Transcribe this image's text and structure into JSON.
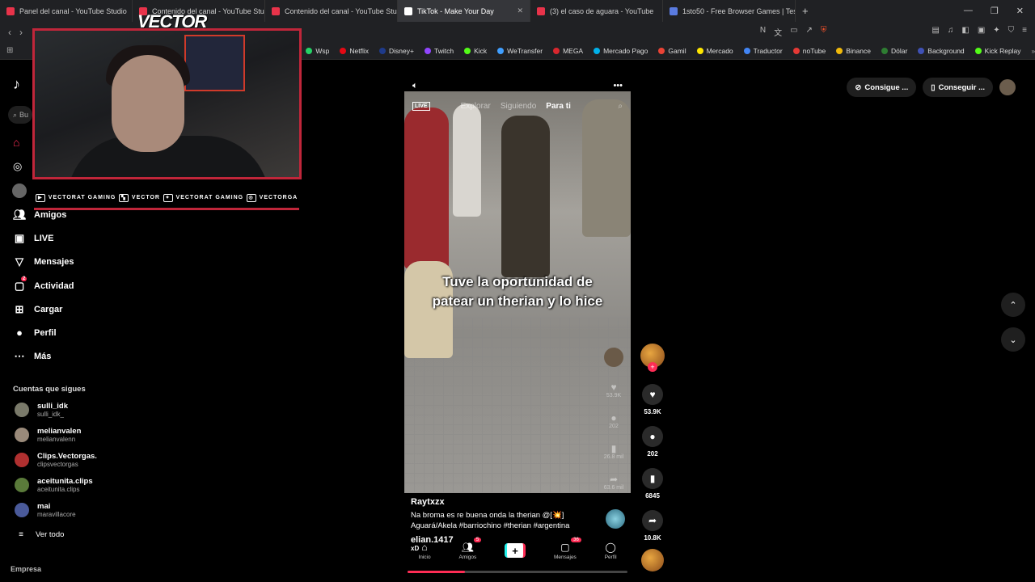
{
  "browser": {
    "tabs": [
      {
        "title": "Panel del canal - YouTube Studio",
        "color": "#e8334a",
        "active": false
      },
      {
        "title": "Contenido del canal - YouTube Studio",
        "color": "#e8334a",
        "active": false
      },
      {
        "title": "Contenido del canal - YouTube Studio",
        "color": "#e8334a",
        "active": false
      },
      {
        "title": "TikTok - Make Your Day",
        "color": "#ffffff",
        "active": true
      },
      {
        "title": "(3) el caso de aguara - YouTube",
        "color": "#e8334a",
        "active": false
      },
      {
        "title": "1sto50 - Free Browser Games | Test Y",
        "color": "#5a7be0",
        "active": false
      }
    ],
    "bookmarks": [
      {
        "label": "Wsp",
        "color": "#25d366"
      },
      {
        "label": "Netflix",
        "color": "#e50914"
      },
      {
        "label": "Disney+",
        "color": "#1e3a8a"
      },
      {
        "label": "Twitch",
        "color": "#9146ff"
      },
      {
        "label": "Kick",
        "color": "#53fc18"
      },
      {
        "label": "WeTransfer",
        "color": "#409fff"
      },
      {
        "label": "MEGA",
        "color": "#d9272e"
      },
      {
        "label": "Mercado Pago",
        "color": "#00b1ea"
      },
      {
        "label": "Gamil",
        "color": "#ea4335"
      },
      {
        "label": "Mercado",
        "color": "#ffe600"
      },
      {
        "label": "Traductor",
        "color": "#4285f4"
      },
      {
        "label": "noTube",
        "color": "#e53935"
      },
      {
        "label": "Binance",
        "color": "#f0b90b"
      },
      {
        "label": "Dólar",
        "color": "#2e7d32"
      },
      {
        "label": "Background",
        "color": "#3f51b5"
      },
      {
        "label": "Kick Replay",
        "color": "#53fc18"
      }
    ]
  },
  "overlay": {
    "logo": "VECTOR",
    "socials": [
      {
        "icon": "youtube-icon",
        "label": "VECTORAT GAMING"
      },
      {
        "icon": "twitch-icon",
        "label": "VECTOR"
      },
      {
        "icon": "twitter-icon",
        "label": "VECTORAT GAMING"
      },
      {
        "icon": "instagram-icon",
        "label": "VECTORGA"
      }
    ]
  },
  "sidebar": {
    "items": [
      {
        "label": "Amigos",
        "icon": "users-icon"
      },
      {
        "label": "LIVE",
        "icon": "live-icon"
      },
      {
        "label": "Mensajes",
        "icon": "send-icon"
      },
      {
        "label": "Actividad",
        "icon": "inbox-icon",
        "badge": "2"
      },
      {
        "label": "Cargar",
        "icon": "upload-icon"
      },
      {
        "label": "Perfil",
        "icon": "profile-icon"
      },
      {
        "label": "Más",
        "icon": "more-icon"
      }
    ],
    "following_title": "Cuentas que sigues",
    "accounts": [
      {
        "name": "sulli_idk",
        "user": "sulli_idk_"
      },
      {
        "name": "melianvalen",
        "user": "melianvalenn"
      },
      {
        "name": "Clips.Vectorgas.",
        "user": "clipsvectorgas"
      },
      {
        "name": "aceitunita.clips",
        "user": "aceitunita.clips"
      },
      {
        "name": "mai",
        "user": "maravillacore"
      }
    ],
    "see_all": "Ver todo",
    "footer": "Empresa"
  },
  "video": {
    "tabs": [
      "Explorar",
      "Siguiendo",
      "Para ti"
    ],
    "live": "LIVE",
    "caption_line1": "Tuve la oportunidad de",
    "caption_line2": "patear un therian y lo hice",
    "author": "Raytxzx",
    "description": "Na broma es re buena onda la therian @[💥] Aguará/Akela #barriochino #therian #argentina",
    "comment_user": "elian.1417",
    "comment_text": "xD",
    "progress": 0.26,
    "ghost_counts": [
      "53.9K",
      "202",
      "26.8 mil",
      "63.6 mil"
    ],
    "bottom_nav": [
      {
        "label": "Inicio",
        "icon": "home-icon"
      },
      {
        "label": "Amigos",
        "icon": "friends-icon",
        "badge": "5"
      },
      {
        "label": "",
        "icon": "plus-icon"
      },
      {
        "label": "Mensajes",
        "icon": "inbox-icon",
        "badge": "36"
      },
      {
        "label": "Perfil",
        "icon": "profile-icon"
      }
    ]
  },
  "actions": {
    "likes": "53.9K",
    "comments": "202",
    "saves": "6845",
    "shares": "10.8K"
  },
  "topright": {
    "btn1": "Consigue ...",
    "btn2": "Conseguir ..."
  },
  "search": {
    "placeholder": "Bu"
  }
}
